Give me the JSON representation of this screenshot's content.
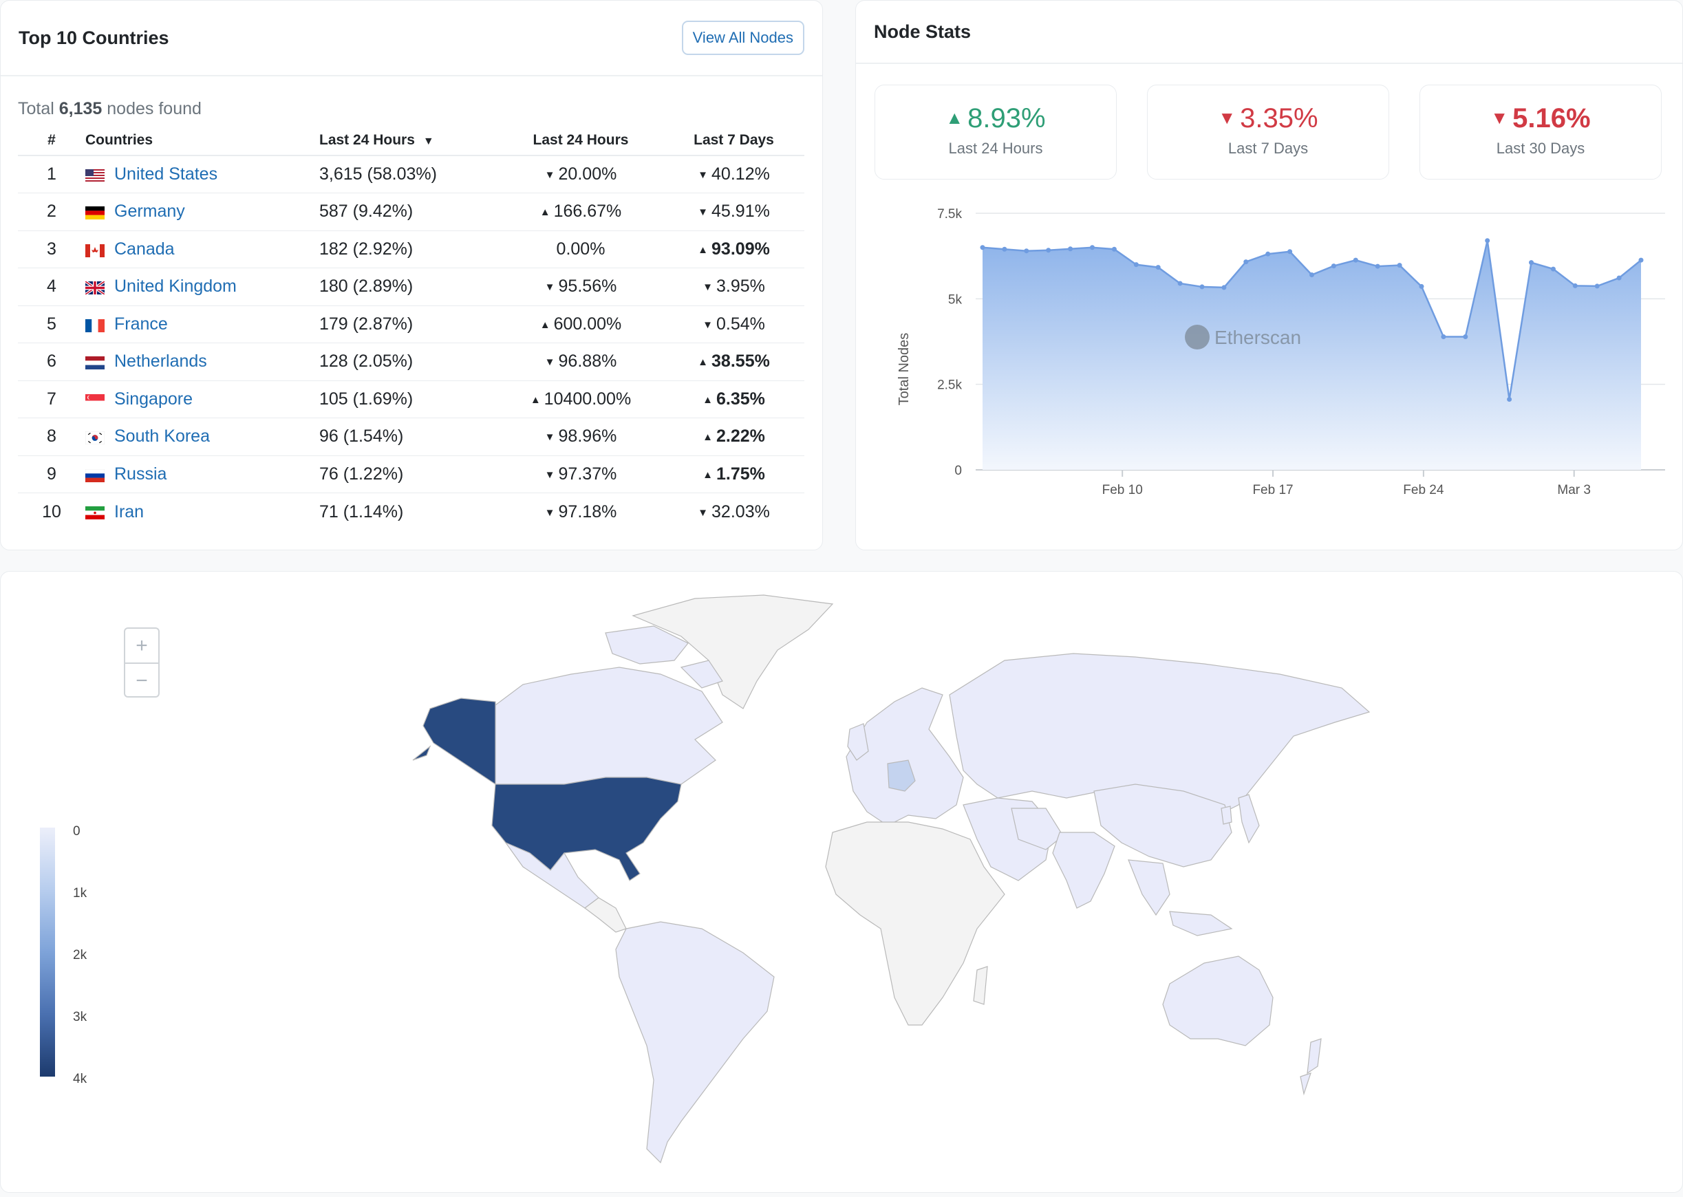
{
  "countries_card": {
    "title": "Top 10 Countries",
    "view_all_label": "View All Nodes",
    "total_prefix": "Total",
    "total_count": "6,135",
    "total_suffix": "nodes found",
    "columns": [
      "#",
      "Countries",
      "Last 24 Hours",
      "Last 24 Hours",
      "Last 7 Days"
    ],
    "rows": [
      {
        "rank": "1",
        "country": "United States",
        "nodes": "3,615 (58.03%)",
        "change24": "20.00%",
        "dir24": "down",
        "change7": "40.12%",
        "dir7": "down",
        "bold7": false
      },
      {
        "rank": "2",
        "country": "Germany",
        "nodes": "587 (9.42%)",
        "change24": "166.67%",
        "dir24": "up",
        "change7": "45.91%",
        "dir7": "down",
        "bold7": false
      },
      {
        "rank": "3",
        "country": "Canada",
        "nodes": "182 (2.92%)",
        "change24": "0.00%",
        "dir24": "none",
        "change7": "93.09%",
        "dir7": "up",
        "bold7": true
      },
      {
        "rank": "4",
        "country": "United Kingdom",
        "nodes": "180 (2.89%)",
        "change24": "95.56%",
        "dir24": "down",
        "change7": "3.95%",
        "dir7": "down",
        "bold7": false
      },
      {
        "rank": "5",
        "country": "France",
        "nodes": "179 (2.87%)",
        "change24": "600.00%",
        "dir24": "up",
        "change7": "0.54%",
        "dir7": "down",
        "bold7": false
      },
      {
        "rank": "6",
        "country": "Netherlands",
        "nodes": "128 (2.05%)",
        "change24": "96.88%",
        "dir24": "down",
        "change7": "38.55%",
        "dir7": "up",
        "bold7": true
      },
      {
        "rank": "7",
        "country": "Singapore",
        "nodes": "105 (1.69%)",
        "change24": "10400.00%",
        "dir24": "up",
        "change7": "6.35%",
        "dir7": "up",
        "bold7": true
      },
      {
        "rank": "8",
        "country": "South Korea",
        "nodes": "96 (1.54%)",
        "change24": "98.96%",
        "dir24": "down",
        "change7": "2.22%",
        "dir7": "up",
        "bold7": true
      },
      {
        "rank": "9",
        "country": "Russia",
        "nodes": "76 (1.22%)",
        "change24": "97.37%",
        "dir24": "down",
        "change7": "1.75%",
        "dir7": "up",
        "bold7": true
      },
      {
        "rank": "10",
        "country": "Iran",
        "nodes": "71 (1.14%)",
        "change24": "97.18%",
        "dir24": "down",
        "change7": "32.03%",
        "dir7": "down",
        "bold7": false
      }
    ]
  },
  "stats_card": {
    "title": "Node Stats",
    "boxes": [
      {
        "value": "8.93%",
        "label": "Last 24 Hours",
        "dir": "up",
        "bold": false
      },
      {
        "value": "3.35%",
        "label": "Last 7 Days",
        "dir": "down",
        "bold": false
      },
      {
        "value": "5.16%",
        "label": "Last 30 Days",
        "dir": "down",
        "bold": true
      }
    ],
    "watermark": "Etherscan"
  },
  "chart_data": {
    "type": "area",
    "ylabel": "Total Nodes",
    "ylim": [
      0,
      7500
    ],
    "yticks": [
      0,
      2500,
      5000,
      7500
    ],
    "ytick_labels": [
      "0",
      "2.5k",
      "5k",
      "7.5k"
    ],
    "xtick_labels": [
      "Feb 10",
      "Feb 17",
      "Feb 24",
      "Mar 3"
    ],
    "xticks_day_index": [
      7,
      14,
      21,
      28
    ],
    "x_day_index": [
      0,
      1,
      2,
      3,
      4,
      5,
      6,
      7,
      8,
      9,
      10,
      11,
      12,
      13,
      14,
      15,
      16,
      17,
      18,
      19,
      20,
      21,
      22,
      23,
      24,
      25,
      26,
      27,
      28,
      29,
      30,
      31,
      32,
      33,
      34,
      35,
      36
    ],
    "values": [
      6500,
      6450,
      6400,
      6420,
      6460,
      6500,
      6450,
      6000,
      5920,
      5450,
      5350,
      5330,
      6080,
      6310,
      6380,
      5700,
      5960,
      6130,
      5950,
      5980,
      5360,
      3890,
      3890,
      6700,
      2060,
      6060,
      5870,
      5380,
      5370,
      5610,
      6130
    ],
    "line_color": "#6f9ce0",
    "fill_top": "#8db3ea",
    "fill_bottom": "#f3f7fd"
  },
  "map": {
    "zoom_in": "+",
    "zoom_out": "−",
    "legend_ticks": [
      "0",
      "1k",
      "2k",
      "3k",
      "4k"
    ],
    "scale_colors": [
      "#eceffa",
      "#1c3a6d"
    ]
  }
}
